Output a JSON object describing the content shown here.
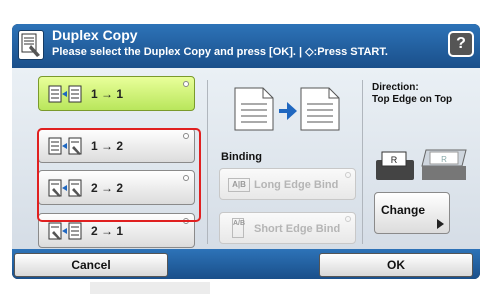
{
  "header": {
    "title": "Duplex Copy",
    "subtitle": "Please select the Duplex Copy and press [OK]. | ◇:Press START.",
    "help_label": "?"
  },
  "modes": [
    {
      "label": "1 → 1",
      "selected": true
    },
    {
      "label": "1 → 2",
      "selected": false
    },
    {
      "label": "2 → 2",
      "selected": false
    },
    {
      "label": "2 → 1",
      "selected": false
    }
  ],
  "binding": {
    "label": "Binding",
    "long_edge": {
      "label": "Long Edge Bind",
      "icon_text": "A|B",
      "enabled": false
    },
    "short_edge": {
      "label": "Short Edge Bind",
      "icon_text": "A/B",
      "enabled": false
    }
  },
  "direction": {
    "label": "Direction:",
    "value": "Top Edge on Top",
    "change_label": "Change"
  },
  "footer": {
    "cancel_label": "Cancel",
    "ok_label": "OK"
  },
  "colors": {
    "title_bar": "#2d73b8",
    "selected_mode": "#c8ee6a",
    "highlight_border": "#e02020"
  }
}
